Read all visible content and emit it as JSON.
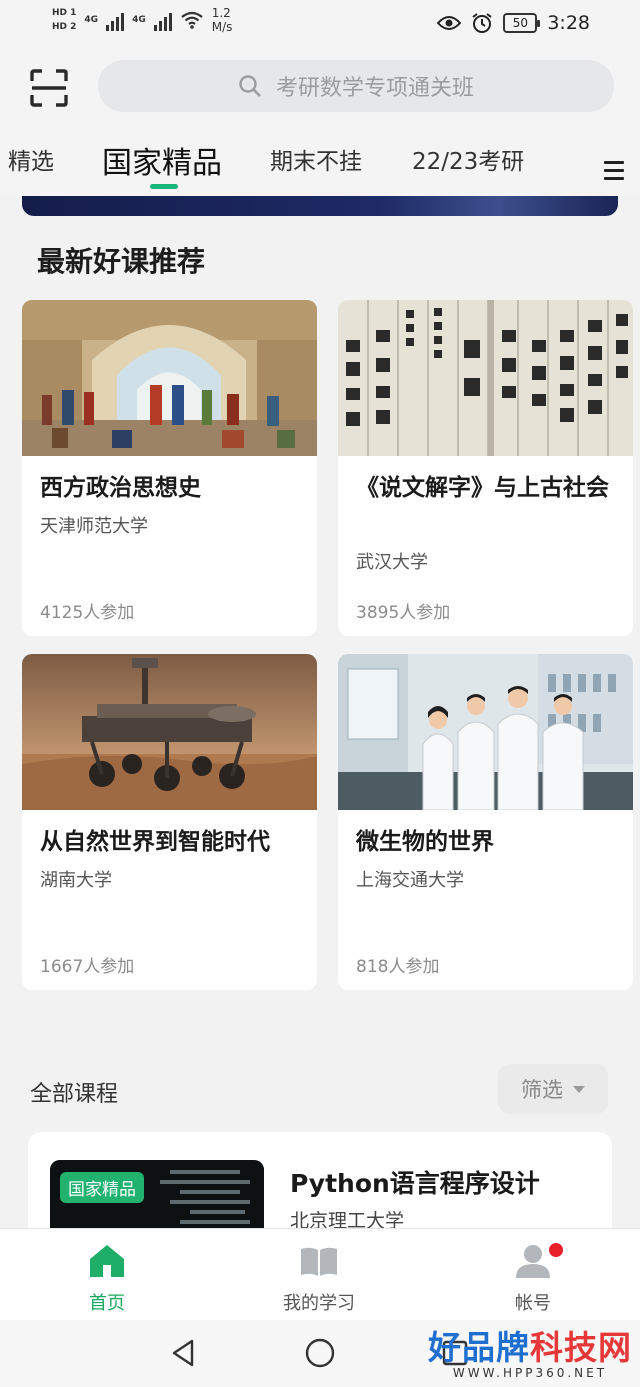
{
  "status_bar": {
    "sim1": "HD 1",
    "sim2": "HD 2",
    "network1": "4G",
    "network2": "4G",
    "speed_value": "1.2",
    "speed_unit": "M/s",
    "battery": "50",
    "time": "3:28"
  },
  "header": {
    "search_placeholder": "考研数学专项通关班"
  },
  "tabs": [
    {
      "label": "精选",
      "active": false
    },
    {
      "label": "国家精品",
      "active": true
    },
    {
      "label": "期末不挂",
      "active": false
    },
    {
      "label": "22/23考研",
      "active": false
    }
  ],
  "recommend": {
    "title": "最新好课推荐",
    "courses": [
      {
        "title": "西方政治思想史",
        "university": "天津师范大学",
        "participants": "4125人参加",
        "image": "painting-image"
      },
      {
        "title": "《说文解字》与上古社会",
        "university": "武汉大学",
        "participants": "3895人参加",
        "image": "ancient-text-image"
      },
      {
        "title": "从自然世界到智能时代",
        "university": "湖南大学",
        "participants": "1667人参加",
        "image": "mars-rover-image"
      },
      {
        "title": "微生物的世界",
        "university": "上海交通大学",
        "participants": "818人参加",
        "image": "lab-image"
      }
    ]
  },
  "all_courses": {
    "title": "全部课程",
    "filter_label": "筛选",
    "items": [
      {
        "tag": "国家精品",
        "title": "Python语言程序设计",
        "university": "北京理工大学"
      }
    ]
  },
  "bottom_nav": [
    {
      "label": "首页",
      "active": true,
      "icon": "home-icon"
    },
    {
      "label": "我的学习",
      "active": false,
      "icon": "book-icon"
    },
    {
      "label": "帐号",
      "active": false,
      "icon": "user-icon"
    }
  ],
  "watermark": {
    "main_blue": "好品牌",
    "main_red": "科技网",
    "sub": "WWW.HPP360.NET"
  },
  "colors": {
    "accent": "#19b57a",
    "nav_active": "#19a95f",
    "tag": "#21b26f",
    "badge": "#e8202a"
  }
}
